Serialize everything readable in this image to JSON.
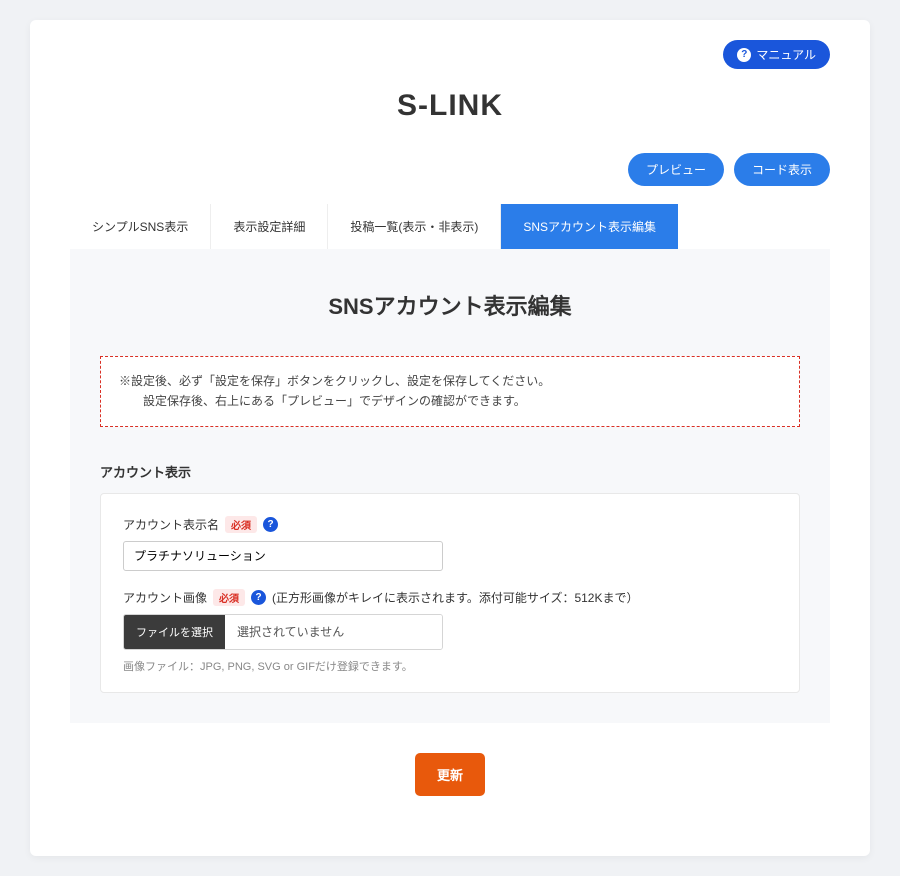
{
  "header": {
    "manual_label": "マニュアル",
    "logo": "S-LINK"
  },
  "actions": {
    "preview_label": "プレビュー",
    "code_label": "コード表示"
  },
  "tabs": [
    {
      "label": "シンプルSNS表示"
    },
    {
      "label": "表示設定詳細"
    },
    {
      "label": "投稿一覧(表示・非表示)"
    },
    {
      "label": "SNSアカウント表示編集"
    }
  ],
  "panel": {
    "title": "SNSアカウント表示編集",
    "notice_line1": "※設定後、必ず「設定を保存」ボタンをクリックし、設定を保存してください。",
    "notice_line2": "　　設定保存後、右上にある「プレビュー」でデザインの確認ができます。",
    "section_label": "アカウント表示"
  },
  "form": {
    "name_label": "アカウント表示名",
    "required_badge": "必須",
    "name_value": "プラチナソリューション",
    "image_label": "アカウント画像",
    "image_hint": "(正方形画像がキレイに表示されます。添付可能サイズ：512Kまで）",
    "file_button": "ファイルを選択",
    "file_status": "選択されていません",
    "file_formats": "画像ファイル：JPG, PNG, SVG or GIFだけ登録できます。"
  },
  "submit": {
    "label": "更新"
  }
}
